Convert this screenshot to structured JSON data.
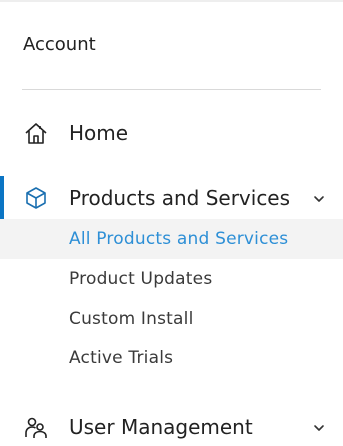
{
  "sidebar": {
    "account_title": "Account",
    "items": [
      {
        "label": "Home",
        "icon": "home-icon"
      },
      {
        "label": "Products and Services",
        "icon": "cube-icon",
        "expanded": true,
        "active": true
      },
      {
        "label": "User Management",
        "icon": "users-icon",
        "expanded": true
      }
    ],
    "subitems": [
      {
        "label": "All Products and Services",
        "selected": true
      },
      {
        "label": "Product Updates"
      },
      {
        "label": "Custom Install"
      },
      {
        "label": "Active Trials"
      }
    ]
  },
  "colors": {
    "accent": "#0b75c4",
    "selected_text": "#2d8fd6",
    "selected_bg": "#f3f3f3",
    "divider": "#d9d9d9"
  }
}
